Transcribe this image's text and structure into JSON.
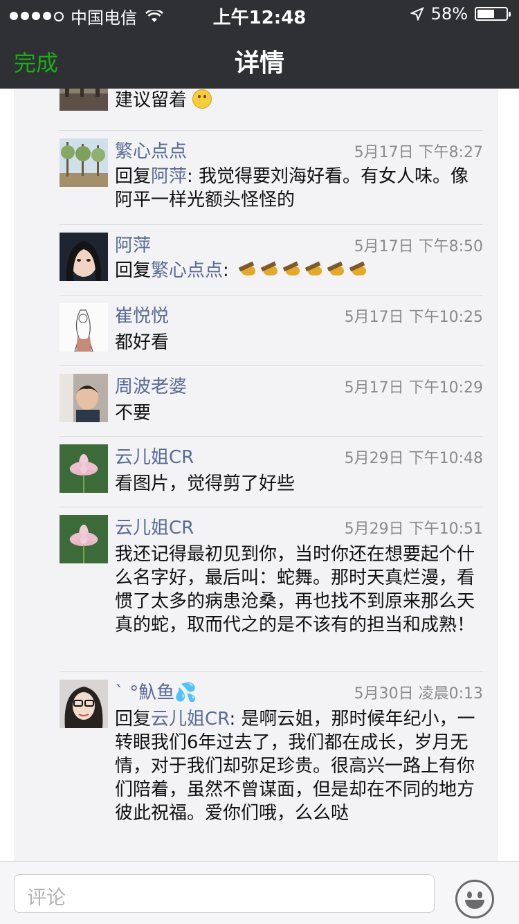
{
  "status_bar": {
    "carrier": "中国电信",
    "time": "上午12:48",
    "battery": "58%",
    "signal_dots_filled": 4
  },
  "nav": {
    "done_label": "完成",
    "title": "详情"
  },
  "comments": [
    {
      "name": "",
      "time": "",
      "text": "建议留着",
      "emoji": "smile",
      "avatar": "trees-avatar"
    },
    {
      "name": "繁心点点",
      "time": "5月17日 下午8:27",
      "reply_prefix": "回复",
      "reply_to": "阿萍",
      "text": ": 我觉得要刘海好看。有女人味。像阿平一样光额头怪怪的"
    },
    {
      "name": "阿萍",
      "time": "5月17日 下午8:50",
      "reply_prefix": "回复",
      "reply_to": "繁心点点",
      "text": ":",
      "emoji": "hammer",
      "emoji_count": 6
    },
    {
      "name": "崔悦悦",
      "time": "5月17日 下午10:25",
      "text": "都好看"
    },
    {
      "name": "周波老婆",
      "time": "5月17日 下午10:29",
      "text": "不要"
    },
    {
      "name": "云儿姐CR",
      "time": "5月29日 下午10:48",
      "text": "看图片，觉得剪了好些"
    },
    {
      "name": "云儿姐CR",
      "time": "5月29日 下午10:51",
      "text": "我还记得最初见到你，当时你还在想要起个什么名字好，最后叫：蛇舞。那时天真烂漫，看惯了太多的病患沧桑，再也找不到原来那么天真的蛇，取而代之的是不该有的担当和成熟！"
    },
    {
      "name": "ˋ °魞鱼💦",
      "time": "5月30日 凌晨0:13",
      "reply_prefix": "回复",
      "reply_to": "云儿姐CR",
      "text": ": 是啊云姐，那时候年纪小，一转眼我们6年过去了，我们都在成长，岁月无情，对于我们却弥足珍贵。很高兴一路上有你们陪着，虽然不曾谋面，但是却在不同的地方彼此祝福。爱你们哦，么么哒"
    }
  ],
  "input": {
    "placeholder": "评论"
  },
  "colors": {
    "nav_background": "#2e3034",
    "done_green": "#1aad19",
    "name_blue": "#576b95",
    "panel_background": "#f3f3f5"
  }
}
